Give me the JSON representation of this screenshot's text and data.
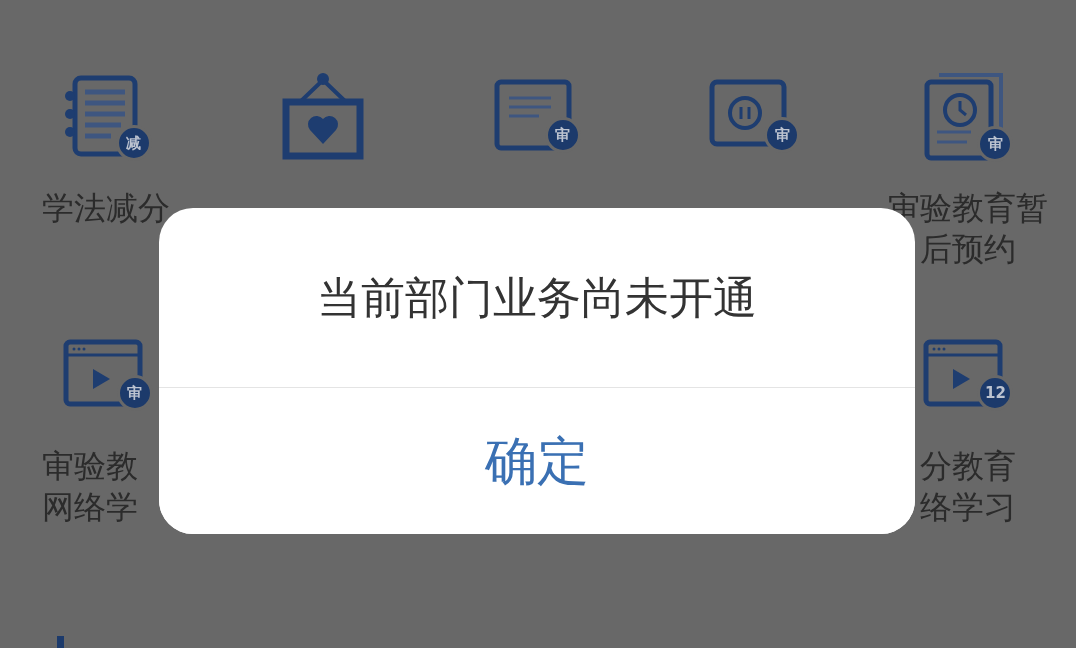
{
  "services": [
    {
      "items": [
        {
          "kind": "notebook",
          "lines": [
            "学法减分"
          ],
          "badge": "减"
        },
        {
          "kind": "frame"
        },
        {
          "kind": "document",
          "badge": "审"
        },
        {
          "kind": "pause",
          "badge": "审"
        },
        {
          "kind": "clock",
          "lines": [
            "审验教育暂",
            "后预约"
          ],
          "badge": "审"
        }
      ]
    },
    {
      "items": [
        {
          "kind": "video",
          "lines": [
            "审验教",
            "网络学"
          ],
          "badge": "审"
        },
        {
          "kind": "video",
          "lines": [
            "分教育",
            "络学习"
          ],
          "badge": "12"
        }
      ]
    }
  ],
  "dialog": {
    "message": "当前部门业务尚未开通",
    "button": "确定"
  }
}
